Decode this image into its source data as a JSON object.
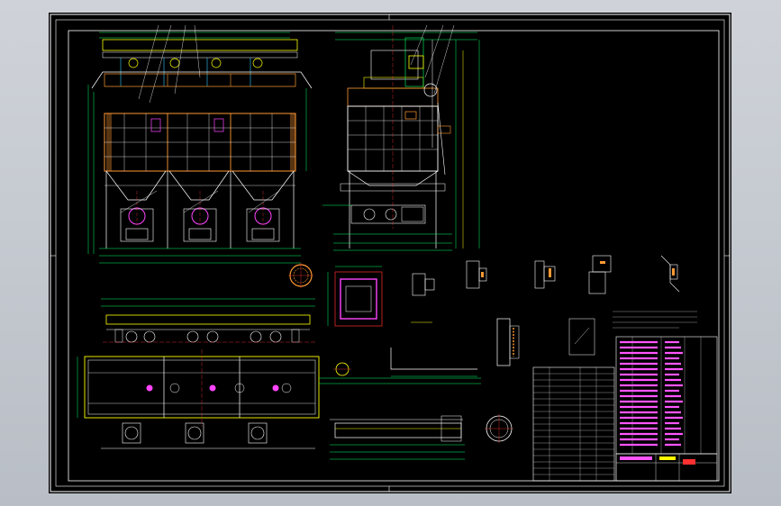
{
  "colors": {
    "background": "#000000",
    "frame": "#ffffff",
    "equipment": "#ffffff",
    "casing": "#ff9933",
    "dimension": "#00ff66",
    "ducting": "#ffff00",
    "centerline": "#ff3030",
    "fan": "#ff44ff",
    "cyan_lines": "#33ccff",
    "magenta_text": "#ff55ff"
  },
  "views": [
    {
      "id": "front-elevation",
      "icon": "front-view-icon"
    },
    {
      "id": "side-elevation",
      "icon": "side-view-icon"
    },
    {
      "id": "plan-view",
      "icon": "plan-view-icon"
    },
    {
      "id": "detail-sections",
      "icon": "section-detail-icon"
    },
    {
      "id": "title-block",
      "icon": "title-block-icon"
    }
  ]
}
